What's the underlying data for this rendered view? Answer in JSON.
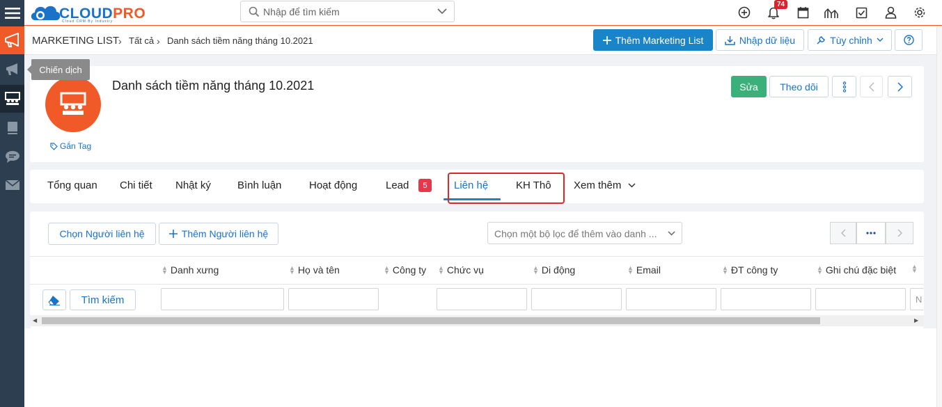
{
  "sidebar": {
    "tooltip": "Chiến dịch",
    "items": [
      {
        "icon": "megaphone-icon"
      },
      {
        "icon": "megaphone-icon"
      },
      {
        "icon": "group-icon"
      },
      {
        "icon": "book-icon"
      },
      {
        "icon": "chat-icon"
      },
      {
        "icon": "mail-icon"
      }
    ]
  },
  "topbar": {
    "logo_main": "CLOUD",
    "logo_accent": "PRO",
    "logo_sub": "Cloud CRM By Industry",
    "search_placeholder": "Nhập để tìm kiếm",
    "notification_count": "74"
  },
  "breadcrumb": {
    "module": "MARKETING LIST",
    "level2": "Tất cả",
    "level3": "Danh sách tiềm năng tháng 10.2021"
  },
  "toolbar": {
    "add_label": "Thêm Marketing List",
    "import_label": "Nhập dữ liệu",
    "customize_label": "Tùy chỉnh"
  },
  "record": {
    "title": "Danh sách tiềm năng tháng 10.2021",
    "tag_label": "Gắn Tag",
    "edit_label": "Sửa",
    "follow_label": "Theo dõi"
  },
  "tabs": {
    "overview": "Tổng quan",
    "detail": "Chi tiết",
    "log": "Nhật ký",
    "comment": "Bình luận",
    "activity": "Hoạt động",
    "lead": "Lead",
    "lead_count": "5",
    "contact": "Liên hệ",
    "raw_customer": "KH Thô",
    "more": "Xem thêm"
  },
  "list": {
    "select_contact_label": "Chọn Người liên hệ",
    "add_contact_label": "Thêm Người liên hệ",
    "filter_placeholder": "Chọn một bộ lọc để thêm vào danh ...",
    "search_button": "Tìm kiếm",
    "columns": [
      "Danh xưng",
      "Họ và tên",
      "Công ty",
      "Chức vụ",
      "Di động",
      "Email",
      "ĐT công ty",
      "Ghi chú đặc biệt"
    ],
    "last_filter_partial": "N"
  },
  "colors": {
    "accent_orange": "#f05a28",
    "primary_blue": "#1a84c9",
    "green": "#3bb07a",
    "sidebar": "#2c3e50",
    "highlight_red": "#e0262b"
  }
}
